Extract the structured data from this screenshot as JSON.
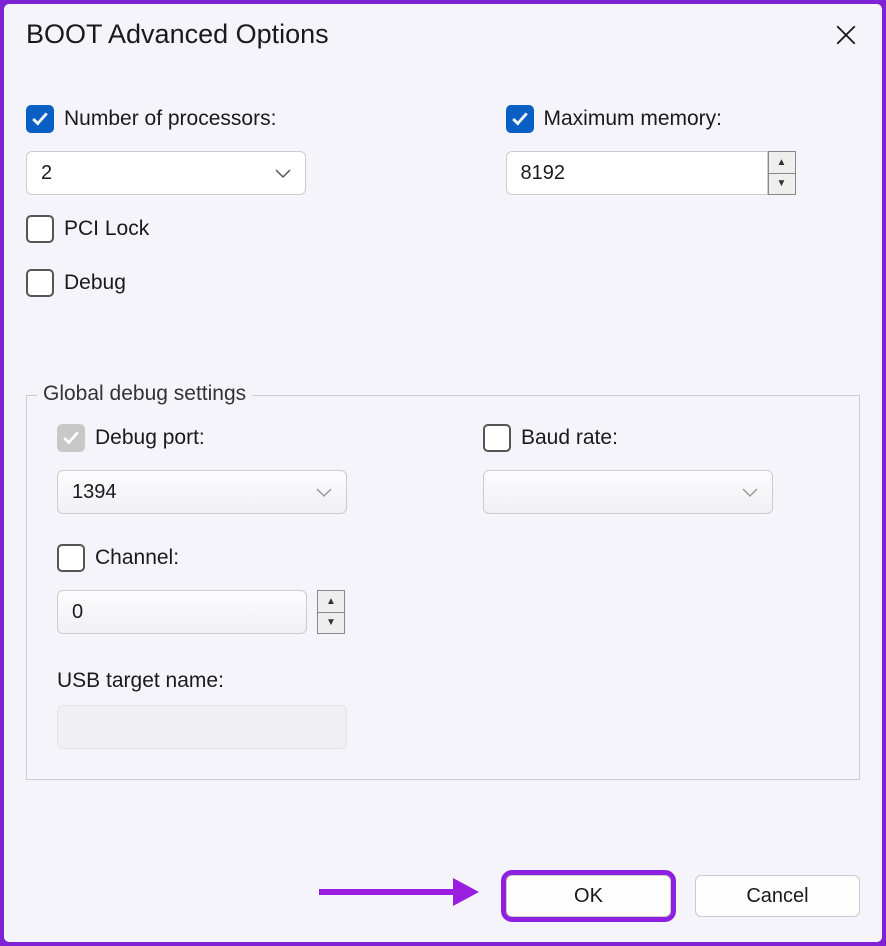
{
  "title": "BOOT Advanced Options",
  "processors": {
    "label": "Number of processors:",
    "checked": true,
    "value": "2"
  },
  "memory": {
    "label": "Maximum memory:",
    "checked": true,
    "value": "8192"
  },
  "pci_lock": {
    "label": "PCI Lock",
    "checked": false
  },
  "debug": {
    "label": "Debug",
    "checked": false
  },
  "global_debug": {
    "legend": "Global debug settings",
    "debug_port": {
      "label": "Debug port:",
      "checked": true,
      "value": "1394"
    },
    "baud_rate": {
      "label": "Baud rate:",
      "checked": false,
      "value": ""
    },
    "channel": {
      "label": "Channel:",
      "checked": false,
      "value": "0"
    },
    "usb_target": {
      "label": "USB target name:",
      "value": ""
    }
  },
  "buttons": {
    "ok": "OK",
    "cancel": "Cancel"
  }
}
